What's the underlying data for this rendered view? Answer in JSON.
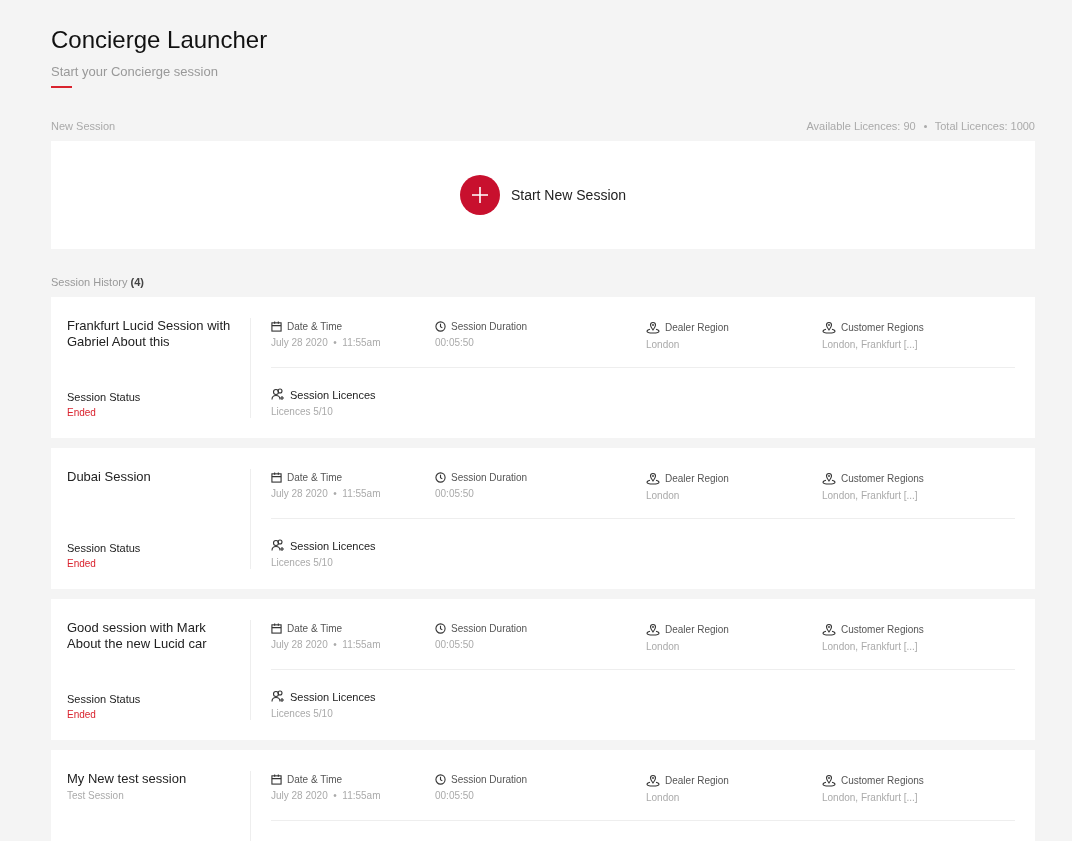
{
  "page": {
    "title": "Concierge Launcher",
    "subtitle": "Start your Concierge session"
  },
  "new_session": {
    "label": "New Session",
    "available": "Available Licences: 90",
    "total": "Total Licences: 1000",
    "button": "Start New Session"
  },
  "history": {
    "label": "Session History",
    "count": "(4)",
    "sessions": [
      {
        "title": "Frankfurt Lucid Session with Gabriel About this",
        "status_label": "Session Status",
        "status": "Ended",
        "fields": [
          {
            "kind": "calendar",
            "label": "Date & Time",
            "value": "July 28 2020  •  11:55am"
          },
          {
            "kind": "clock",
            "label": "Session Duration",
            "value": "00:05:50"
          },
          {
            "kind": "pin",
            "label": "Dealer Region",
            "value": "London"
          },
          {
            "kind": "pin",
            "label": "Customer Regions",
            "value": "London, Frankfurt [...]"
          }
        ],
        "licences": {
          "label": "Session Licences",
          "value": "Licences 5/10"
        }
      },
      {
        "title": "Dubai Session",
        "status_label": "Session Status",
        "status": "Ended",
        "fields": [
          {
            "kind": "calendar",
            "label": "Date & Time",
            "value": "July 28 2020  •  11:55am"
          },
          {
            "kind": "clock",
            "label": "Session Duration",
            "value": "00:05:50"
          },
          {
            "kind": "pin",
            "label": "Dealer Region",
            "value": "London"
          },
          {
            "kind": "pin",
            "label": "Customer Regions",
            "value": "London, Frankfurt [...]"
          }
        ],
        "licences": {
          "label": "Session Licences",
          "value": "Licences 5/10"
        }
      },
      {
        "title": "Good session with Mark About the new Lucid car",
        "status_label": "Session Status",
        "status": "Ended",
        "fields": [
          {
            "kind": "calendar",
            "label": "Date & Time",
            "value": "July 28 2020  •  11:55am"
          },
          {
            "kind": "clock",
            "label": "Session Duration",
            "value": "00:05:50"
          },
          {
            "kind": "pin",
            "label": "Dealer Region",
            "value": "London"
          },
          {
            "kind": "pin",
            "label": "Customer Regions",
            "value": "London, Frankfurt [...]"
          }
        ],
        "licences": {
          "label": "Session Licences",
          "value": "Licences 5/10"
        }
      },
      {
        "title": "My New test session",
        "subtitle": "Test Session",
        "fields": [
          {
            "kind": "calendar",
            "label": "Date & Time",
            "value": "July 28 2020  •  11:55am"
          },
          {
            "kind": "clock",
            "label": "Session Duration",
            "value": "00:05:50"
          },
          {
            "kind": "pin",
            "label": "Dealer Region",
            "value": "London"
          },
          {
            "kind": "pin",
            "label": "Customer Regions",
            "value": "London, Frankfurt [...]"
          }
        ]
      }
    ]
  }
}
